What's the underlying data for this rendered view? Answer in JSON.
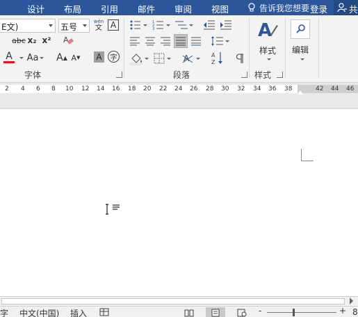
{
  "menu": {
    "tabs": [
      "设计",
      "布局",
      "引用",
      "邮件",
      "审阅",
      "视图"
    ],
    "tell_me": "告诉我您想要",
    "login": "登录",
    "share": "共"
  },
  "font_group": {
    "font_name": "E文)",
    "font_size": "五号",
    "phonetic_top": "wén",
    "phonetic_bottom": "文",
    "border_char": "A",
    "strike": "abc",
    "subscript": "x₂",
    "superscript": "x²",
    "font_color_letter": "A",
    "change_case": "Aa",
    "grow_font": "A",
    "shrink_font": "A",
    "shade_char": "A",
    "enclose_char": "字",
    "label": "字体",
    "font_color_bar": "#e81123"
  },
  "paragraph_group": {
    "label": "段落"
  },
  "styles_group": {
    "styles_label": "样式",
    "group_label": "样式",
    "accent": "#2b579a"
  },
  "editing_group": {
    "label": "编辑"
  },
  "ruler": {
    "numbers": [
      "2",
      "4",
      "6",
      "8",
      "10",
      "12",
      "14",
      "16",
      "18",
      "20",
      "22",
      "24",
      "26",
      "28",
      "30",
      "32",
      "34",
      "36",
      "38",
      "42",
      "44",
      "46"
    ]
  },
  "status": {
    "char_label": "字",
    "language": "中文(中国)",
    "insert_mode": "插入",
    "zoom_minus": "-",
    "zoom_plus": "+",
    "zoom_tail": "8"
  },
  "theme": {
    "title_bar": "#2b579a",
    "ribbon_bg": "#f3f3f3"
  }
}
